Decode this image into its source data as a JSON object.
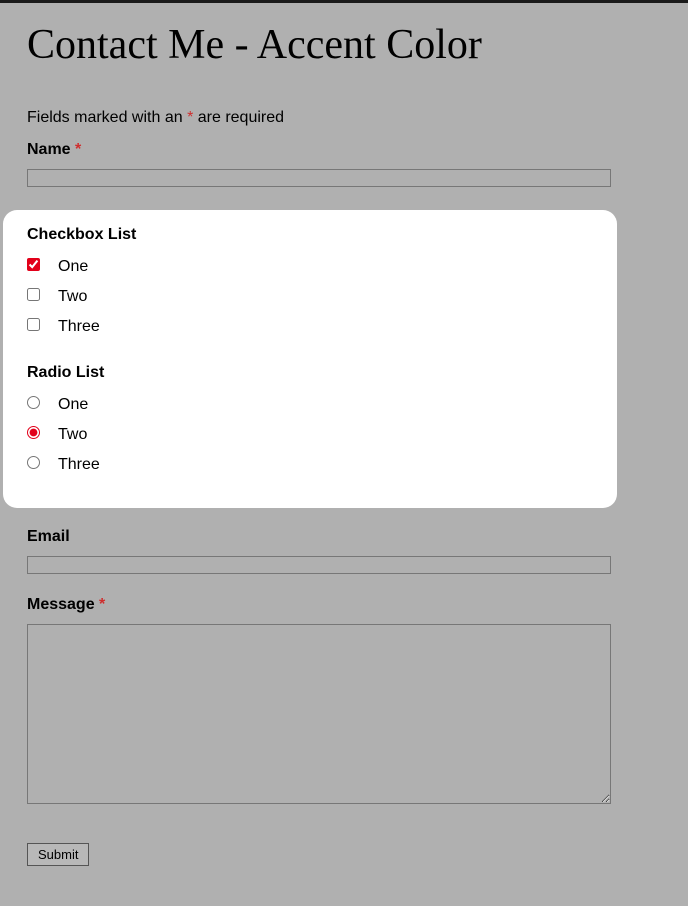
{
  "title": "Contact Me - Accent Color",
  "required_note_prefix": "Fields marked with an ",
  "required_note_asterisk": "*",
  "required_note_suffix": " are required",
  "asterisk": "*",
  "fields": {
    "name": {
      "label": "Name ",
      "value": ""
    },
    "email": {
      "label": "Email",
      "value": ""
    },
    "message": {
      "label": "Message ",
      "value": ""
    }
  },
  "checkbox_group": {
    "label": "Checkbox List",
    "options": [
      {
        "label": "One",
        "checked": true
      },
      {
        "label": "Two",
        "checked": false
      },
      {
        "label": "Three",
        "checked": false
      }
    ]
  },
  "radio_group": {
    "label": "Radio List",
    "options": [
      {
        "label": "One",
        "checked": false
      },
      {
        "label": "Two",
        "checked": true
      },
      {
        "label": "Three",
        "checked": false
      }
    ]
  },
  "submit_label": "Submit",
  "accent_color": "#e2001a"
}
